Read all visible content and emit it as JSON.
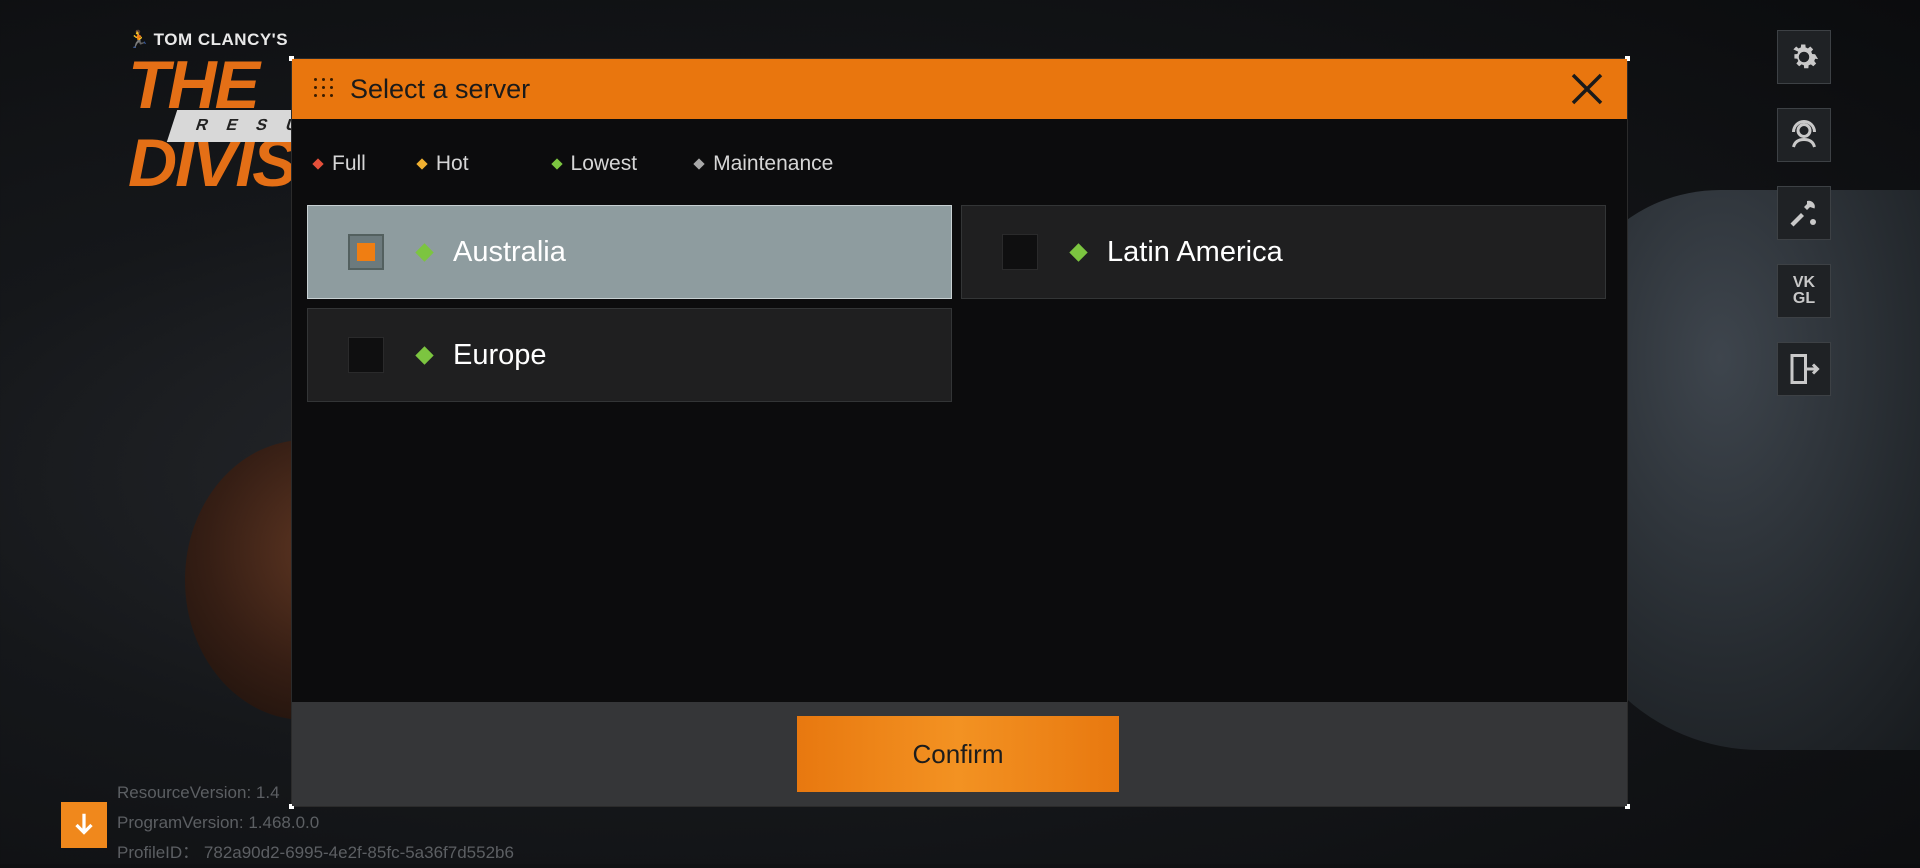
{
  "logo": {
    "top_text": "TOM CLANCY'S",
    "main_text": "THE DIVISION",
    "sub_text": "RESURGENCE"
  },
  "dialog": {
    "title": "Select a server",
    "close_icon": "close-icon",
    "legend": [
      {
        "label": "Full",
        "color": "#e5503a"
      },
      {
        "label": "Hot",
        "color": "#f0b030"
      },
      {
        "label": "Lowest",
        "color": "#7cc540"
      },
      {
        "label": "Maintenance",
        "color": "#a8a8a8"
      }
    ],
    "servers": [
      {
        "name": "Australia",
        "status_color": "#7cc540",
        "selected": true
      },
      {
        "name": "Latin America",
        "status_color": "#7cc540",
        "selected": false
      },
      {
        "name": "Europe",
        "status_color": "#7cc540",
        "selected": false
      }
    ],
    "confirm_label": "Confirm"
  },
  "side_icons": [
    "gear-icon",
    "support-headset-icon",
    "repair-tools-icon",
    "vk-gl-icon",
    "exit-icon"
  ],
  "vk_icon": {
    "line1": "VK",
    "line2": "GL"
  },
  "info": {
    "resource_version": "ResourceVersion: 1.4",
    "program_version": "ProgramVersion: 1.468.0.0",
    "profile_id": "ProfileID： 782a90d2-6995-4e2f-85fc-5a36f7d552b6"
  },
  "colors": {
    "accent": "#e9760e",
    "selected_row": "#8e9c9f",
    "footer": "#353638"
  }
}
